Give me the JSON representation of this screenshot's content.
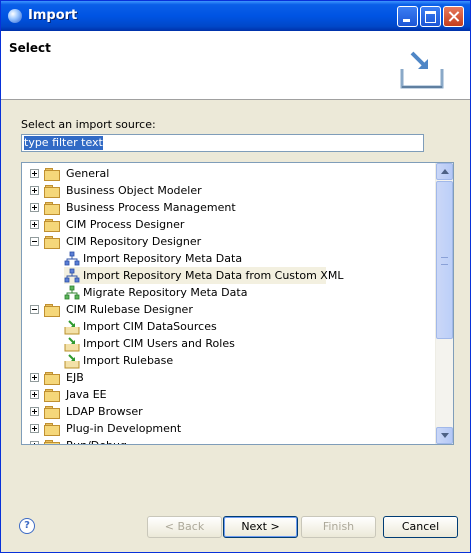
{
  "window": {
    "title": "Import"
  },
  "banner": {
    "title": "Select"
  },
  "source_label": "Select an import source:",
  "filter": {
    "value": "type filter text"
  },
  "tree": [
    {
      "label": "General",
      "kind": "folder",
      "state": "collapsed",
      "level": 0
    },
    {
      "label": "Business Object Modeler",
      "kind": "folder",
      "state": "collapsed",
      "level": 0
    },
    {
      "label": "Business Process Management",
      "kind": "folder",
      "state": "collapsed",
      "level": 0
    },
    {
      "label": "CIM Process Designer",
      "kind": "folder",
      "state": "collapsed",
      "level": 0
    },
    {
      "label": "CIM Repository Designer",
      "kind": "folder",
      "state": "expanded",
      "level": 0
    },
    {
      "label": "Import Repository Meta Data",
      "kind": "item",
      "icon": "repository-import-icon",
      "level": 1
    },
    {
      "label": "Import Repository Meta Data from Custom XML",
      "kind": "item",
      "icon": "repository-import-icon",
      "level": 1,
      "selected": true
    },
    {
      "label": "Migrate Repository Meta Data",
      "kind": "item",
      "icon": "repository-migrate-icon",
      "level": 1
    },
    {
      "label": "CIM Rulebase Designer",
      "kind": "folder",
      "state": "expanded",
      "level": 0
    },
    {
      "label": "Import CIM DataSources",
      "kind": "item",
      "icon": "import-arrow-icon",
      "level": 1
    },
    {
      "label": "Import CIM Users and Roles",
      "kind": "item",
      "icon": "import-arrow-icon",
      "level": 1
    },
    {
      "label": "Import Rulebase",
      "kind": "item",
      "icon": "import-arrow-icon",
      "level": 1
    },
    {
      "label": "EJB",
      "kind": "folder",
      "state": "collapsed",
      "level": 0
    },
    {
      "label": "Java EE",
      "kind": "folder",
      "state": "collapsed",
      "level": 0
    },
    {
      "label": "LDAP Browser",
      "kind": "folder",
      "state": "collapsed",
      "level": 0
    },
    {
      "label": "Plug-in Development",
      "kind": "folder",
      "state": "collapsed",
      "level": 0
    },
    {
      "label": "Run/Debug",
      "kind": "folder",
      "state": "collapsed",
      "level": 0
    }
  ],
  "buttons": {
    "back": "< Back",
    "next": "Next >",
    "finish": "Finish",
    "cancel": "Cancel"
  },
  "help": "?",
  "colors": {
    "titlebar": "#0054e3",
    "selection": "#316ac5",
    "dialog_bg": "#ece9d8"
  }
}
